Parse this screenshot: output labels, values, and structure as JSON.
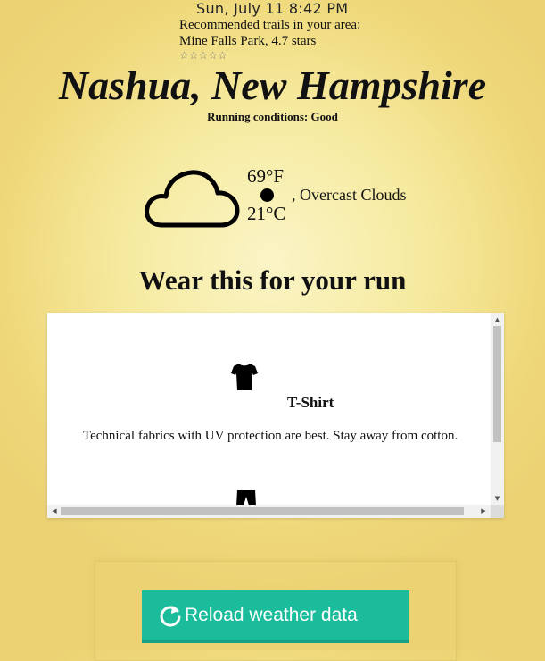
{
  "datetime": "Sun, July 11 8:42 PM",
  "trails": {
    "heading": "Recommended trails in your area:",
    "entry": "Mine Falls Park, 4.7 stars",
    "stars": "☆☆☆☆☆"
  },
  "location": {
    "city": "Nashua, New Hampshire"
  },
  "running_conditions": "Running conditions: Good",
  "weather": {
    "temp_f": "69°F",
    "temp_c": "21°C",
    "description": ", Overcast Clouds",
    "icon": "cloud-icon"
  },
  "wear": {
    "title": "Wear this for your run",
    "items": [
      {
        "name": "T-Shirt",
        "description": "Technical fabrics with UV protection are best. Stay away from cotton.",
        "icon": "tshirt-icon"
      },
      {
        "icon": "shorts-icon"
      }
    ]
  },
  "reload_label": "Reload weather data",
  "colors": {
    "button": "#1abc9c",
    "button_border": "#16a085",
    "background": "#f6ea9f"
  }
}
